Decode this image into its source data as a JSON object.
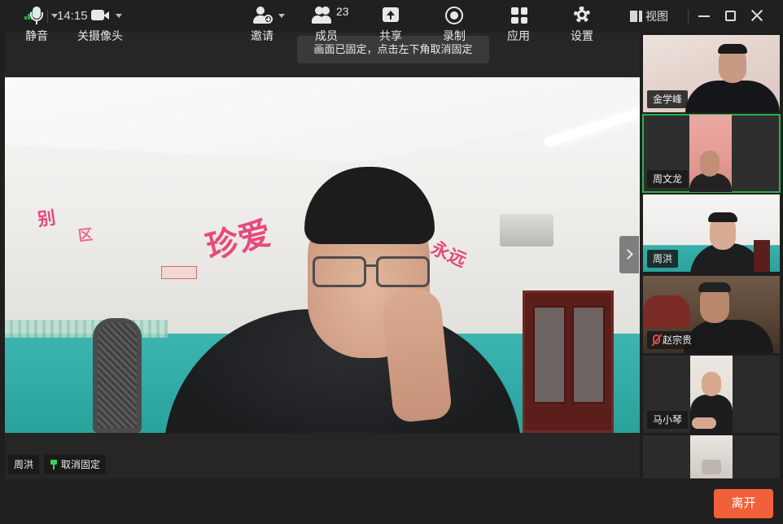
{
  "titlebar": {
    "time": "14:15",
    "view_label": "视图"
  },
  "stage": {
    "toast": "画面已固定，点击左下角取消固定",
    "pinned_name": "周洪",
    "unpin_label": "取消固定",
    "wall_text_left": "别",
    "wall_text_left2": "区",
    "wall_text_main": "珍爱",
    "wall_text_right": "永远"
  },
  "participants": [
    {
      "name": "金学峰",
      "muted": false,
      "active": false
    },
    {
      "name": "周文龙",
      "muted": false,
      "active": true
    },
    {
      "name": "周洪",
      "muted": false,
      "active": false
    },
    {
      "name": "赵宗贵",
      "muted": true,
      "active": false
    },
    {
      "name": "马小琴",
      "muted": false,
      "active": false
    },
    {
      "name": "",
      "muted": false,
      "active": false
    }
  ],
  "toolbar": {
    "mute_label": "静音",
    "camera_label": "关摄像头",
    "invite_label": "邀请",
    "members_label": "成员",
    "members_count": "23",
    "share_label": "共享",
    "record_label": "录制",
    "apps_label": "应用",
    "settings_label": "设置",
    "leave_label": "离开"
  },
  "colors": {
    "accent_green": "#22b24c",
    "leave_orange": "#f0613a",
    "background": "#1f1f1f"
  },
  "icons": [
    "signal-icon",
    "dropdown-caret-icon",
    "view-layout-icon",
    "minimize-icon",
    "maximize-icon",
    "close-icon",
    "pin-icon",
    "chevron-right-icon",
    "microphone-icon",
    "camera-icon",
    "invite-user-icon",
    "members-icon",
    "share-screen-icon",
    "record-icon",
    "apps-grid-icon",
    "settings-gear-icon",
    "mic-muted-icon"
  ]
}
